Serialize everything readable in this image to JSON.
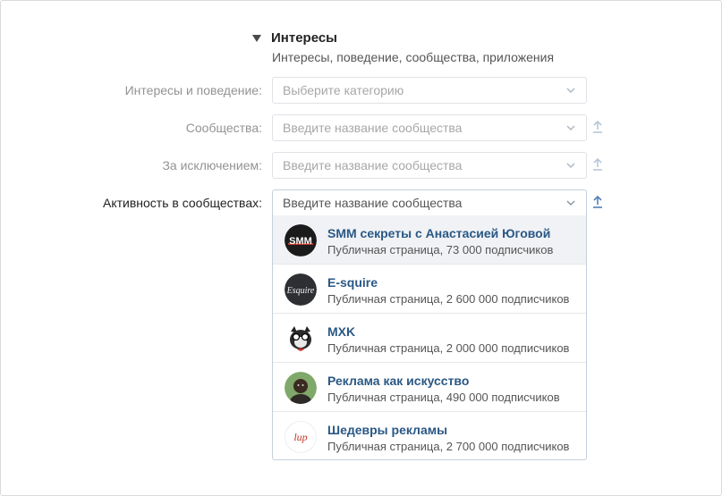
{
  "section": {
    "title": "Интересы",
    "subtitle": "Интересы, поведение, сообщества, приложения"
  },
  "rows": [
    {
      "label": "Интересы и поведение:",
      "placeholder": "Выберите категорию"
    },
    {
      "label": "Сообщества:",
      "placeholder": "Введите название сообщества"
    },
    {
      "label": "За исключением:",
      "placeholder": "Введите название сообщества"
    },
    {
      "label": "Активность в сообществах:",
      "placeholder": "Введите название сообщества"
    }
  ],
  "dropdown": {
    "items": [
      {
        "name": "SMM секреты с Анастасией Юговой",
        "meta": "Публичная страница, 73 000 подписчиков",
        "avatar_text": "SMM"
      },
      {
        "name": "E-squire",
        "meta": "Публичная страница, 2 600 000 подписчиков",
        "avatar_text": "Esquire"
      },
      {
        "name": "MXK",
        "meta": "Публичная страница, 2 000 000 подписчиков",
        "avatar_icon": "cat-with-glasses-icon"
      },
      {
        "name": "Реклама как искусство",
        "meta": "Публичная страница, 490 000 подписчиков",
        "avatar_icon": "person-photo-icon"
      },
      {
        "name": "Шедевры рекламы",
        "meta": "Публичная страница, 2 700 000 подписчиков",
        "avatar_text": "lup"
      }
    ]
  },
  "colors": {
    "link": "#2a5885",
    "hover_row": "#f0f2f5",
    "upload_icon": "#5181b8"
  }
}
